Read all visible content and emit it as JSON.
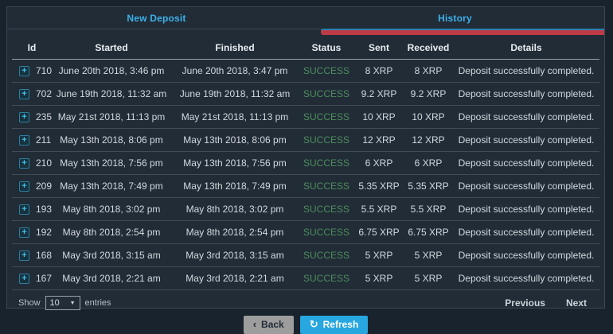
{
  "tabs": [
    {
      "label": "New Deposit",
      "active": false
    },
    {
      "label": "History",
      "active": true
    }
  ],
  "table": {
    "headers": [
      "Id",
      "Started",
      "Finished",
      "Status",
      "Sent",
      "Received",
      "Details"
    ],
    "rows": [
      {
        "id": "710",
        "started": "June 20th 2018, 3:46 pm",
        "finished": "June 20th 2018, 3:47 pm",
        "status": "SUCCESS",
        "sent": "8 XRP",
        "received": "8 XRP",
        "details": "Deposit successfully completed."
      },
      {
        "id": "702",
        "started": "June 19th 2018, 11:32 am",
        "finished": "June 19th 2018, 11:32 am",
        "status": "SUCCESS",
        "sent": "9.2 XRP",
        "received": "9.2 XRP",
        "details": "Deposit successfully completed."
      },
      {
        "id": "235",
        "started": "May 21st 2018, 11:13 pm",
        "finished": "May 21st 2018, 11:13 pm",
        "status": "SUCCESS",
        "sent": "10 XRP",
        "received": "10 XRP",
        "details": "Deposit successfully completed."
      },
      {
        "id": "211",
        "started": "May 13th 2018, 8:06 pm",
        "finished": "May 13th 2018, 8:06 pm",
        "status": "SUCCESS",
        "sent": "12 XRP",
        "received": "12 XRP",
        "details": "Deposit successfully completed."
      },
      {
        "id": "210",
        "started": "May 13th 2018, 7:56 pm",
        "finished": "May 13th 2018, 7:56 pm",
        "status": "SUCCESS",
        "sent": "6 XRP",
        "received": "6 XRP",
        "details": "Deposit successfully completed."
      },
      {
        "id": "209",
        "started": "May 13th 2018, 7:49 pm",
        "finished": "May 13th 2018, 7:49 pm",
        "status": "SUCCESS",
        "sent": "5.35 XRP",
        "received": "5.35 XRP",
        "details": "Deposit successfully completed."
      },
      {
        "id": "193",
        "started": "May 8th 2018, 3:02 pm",
        "finished": "May 8th 2018, 3:02 pm",
        "status": "SUCCESS",
        "sent": "5.5 XRP",
        "received": "5.5 XRP",
        "details": "Deposit successfully completed."
      },
      {
        "id": "192",
        "started": "May 8th 2018, 2:54 pm",
        "finished": "May 8th 2018, 2:54 pm",
        "status": "SUCCESS",
        "sent": "6.75 XRP",
        "received": "6.75 XRP",
        "details": "Deposit successfully completed."
      },
      {
        "id": "168",
        "started": "May 3rd 2018, 3:15 am",
        "finished": "May 3rd 2018, 3:15 am",
        "status": "SUCCESS",
        "sent": "5 XRP",
        "received": "5 XRP",
        "details": "Deposit successfully completed."
      },
      {
        "id": "167",
        "started": "May 3rd 2018, 2:21 am",
        "finished": "May 3rd 2018, 2:21 am",
        "status": "SUCCESS",
        "sent": "5 XRP",
        "received": "5 XRP",
        "details": "Deposit successfully completed."
      }
    ]
  },
  "footer": {
    "show_label": "Show",
    "page_size": "10",
    "entries_label": "entries",
    "previous_label": "Previous",
    "next_label": "Next"
  },
  "actions": {
    "back_label": "Back",
    "refresh_label": "Refresh"
  },
  "icons": {
    "expand": "+",
    "back_chevron": "‹",
    "refresh": "↻",
    "select_arrow": "▼"
  },
  "colors": {
    "panel_background": "#212c37",
    "tab_text": "#3cb1e9",
    "active_tab_underline_red": "#bf3a47",
    "active_tab_underline_blue": "#2d7fad",
    "status_success_green": "#4e8d5c",
    "back_button_gray": "#9d9d9d",
    "refresh_button_blue": "#27a6e0"
  }
}
